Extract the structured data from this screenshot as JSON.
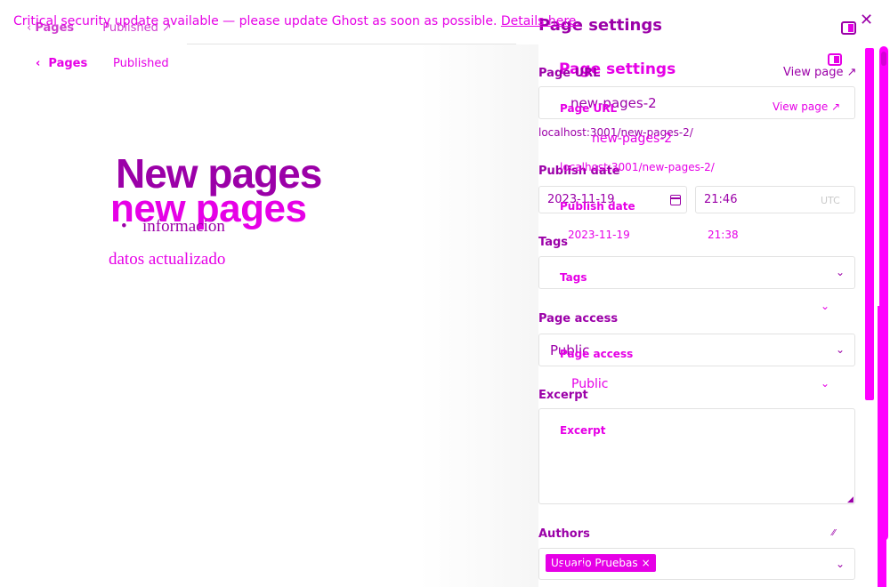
{
  "banner": {
    "message": "Critical security update available — please update Ghost as soon as possible.",
    "link": "Details here."
  },
  "breadcrumb": {
    "back_label": "Pages",
    "status": "Published"
  },
  "editor": {
    "title": "New pages",
    "title_ghost": "new pages",
    "bullets": [
      "información"
    ],
    "paragraph": "datos actualizado"
  },
  "settings": {
    "title": "Page settings",
    "page_url_label": "Page URL",
    "view_page": "View page",
    "url_value": "new-pages-2",
    "url_hint": "localhost:3001/new-pages-2/",
    "publish_date_label": "Publish date",
    "date_value": "2023-11-19",
    "time_value": "21:46",
    "timezone": "UTC",
    "ghost_time_value": "21:38",
    "tags_label": "Tags",
    "access_label": "Page access",
    "access_value": "Public",
    "excerpt_label": "Excerpt",
    "authors_label": "Authors",
    "author_chip": "Usuario Pruebas"
  },
  "colors": {
    "accent": "#e600e6",
    "dark_accent": "#9b00a8",
    "scrollbar": "#ff00ff"
  },
  "icons": [
    "chevron-left-icon",
    "arrow-up-right-icon",
    "calendar-icon",
    "chevron-down-icon",
    "sidebar-toggle-icon",
    "close-icon",
    "resize-handle-icon"
  ]
}
